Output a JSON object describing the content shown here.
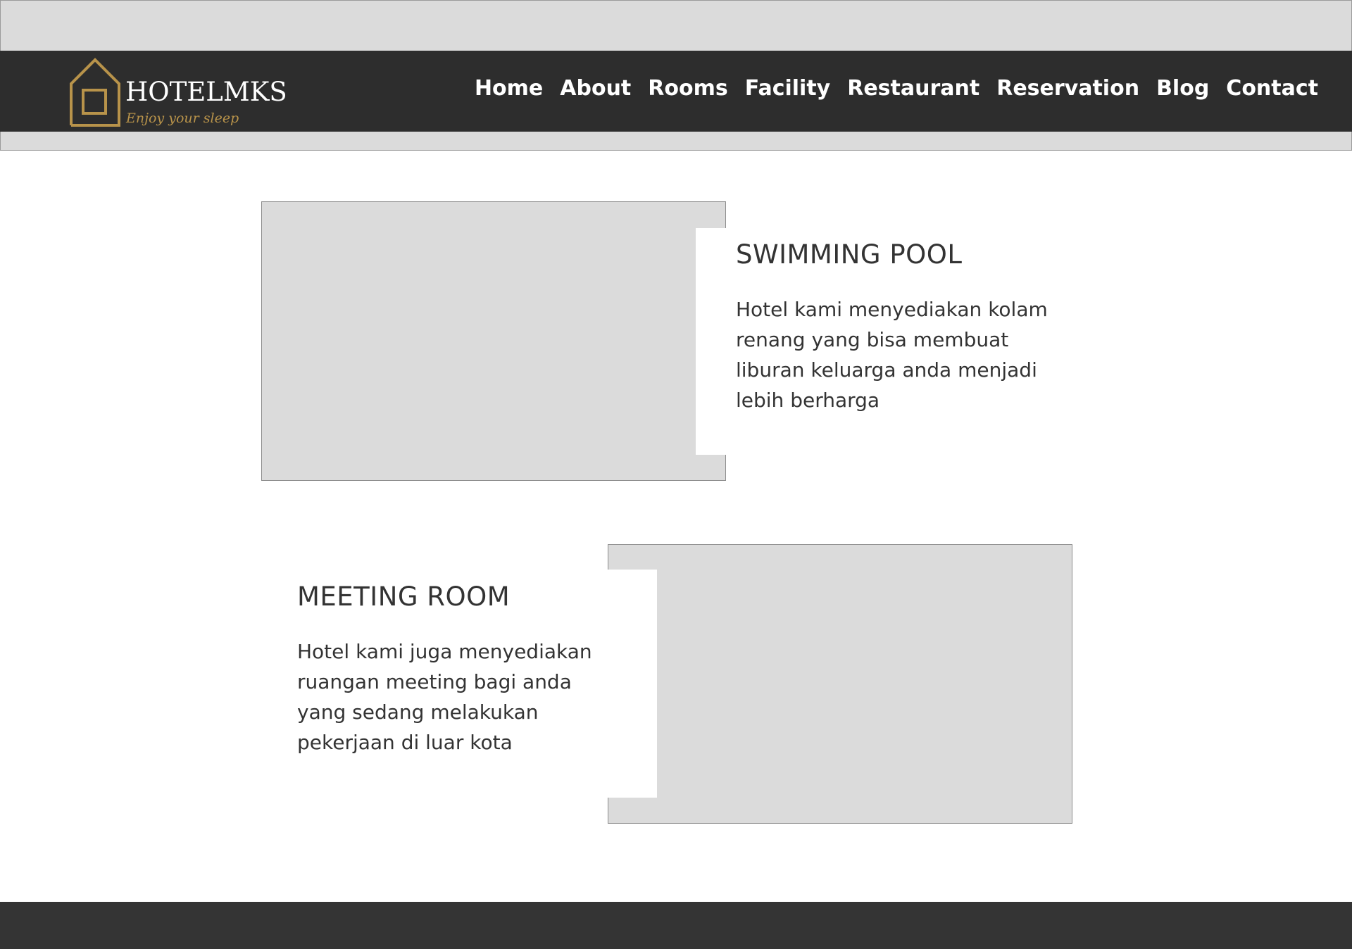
{
  "brand": {
    "name": "HOTELMKS",
    "tagline": "Enjoy your sleep",
    "logo_icon": "house-icon",
    "accent_color": "#b8934a"
  },
  "nav": {
    "items": [
      {
        "label": "Home"
      },
      {
        "label": "About"
      },
      {
        "label": "Rooms"
      },
      {
        "label": "Facility"
      },
      {
        "label": "Restaurant"
      },
      {
        "label": "Reservation"
      },
      {
        "label": "Blog"
      },
      {
        "label": "Contact"
      }
    ]
  },
  "facilities": [
    {
      "title": "SWIMMING POOL",
      "description": "Hotel kami menyediakan kolam renang yang bisa membuat liburan keluarga anda menjadi lebih berharga"
    },
    {
      "title": "MEETING ROOM",
      "description": "Hotel kami juga menyediakan ruangan meeting bagi anda yang sedang melakukan pekerjaan di luar kota"
    }
  ],
  "colors": {
    "header_bg": "#2d2d2d",
    "placeholder_bg": "#dbdbdb",
    "text": "#333333",
    "footer_bg": "#343434"
  }
}
